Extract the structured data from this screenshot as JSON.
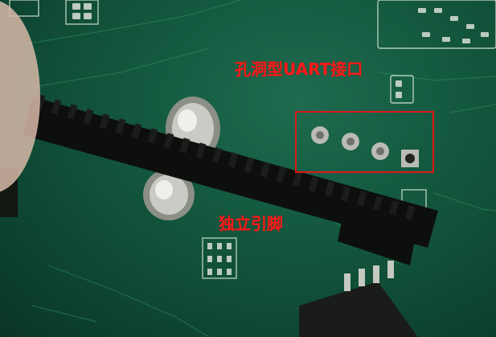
{
  "annotations": {
    "uart_header_label": "孔洞型UART接口",
    "standalone_pins_label": "独立引脚"
  },
  "colors": {
    "board_green": "#145a40",
    "annotation_red": "#ff1a1a",
    "highlight_red": "#e01818",
    "silkscreen": "#dfe9df",
    "pin_strip": "#111111"
  },
  "icons": {
    "uart_pads": "four-round-solder-pads",
    "pin_header": "black-pin-header-strip",
    "mounting_pads": "oval-metal-pads",
    "chip": "soic-ic-chip"
  }
}
